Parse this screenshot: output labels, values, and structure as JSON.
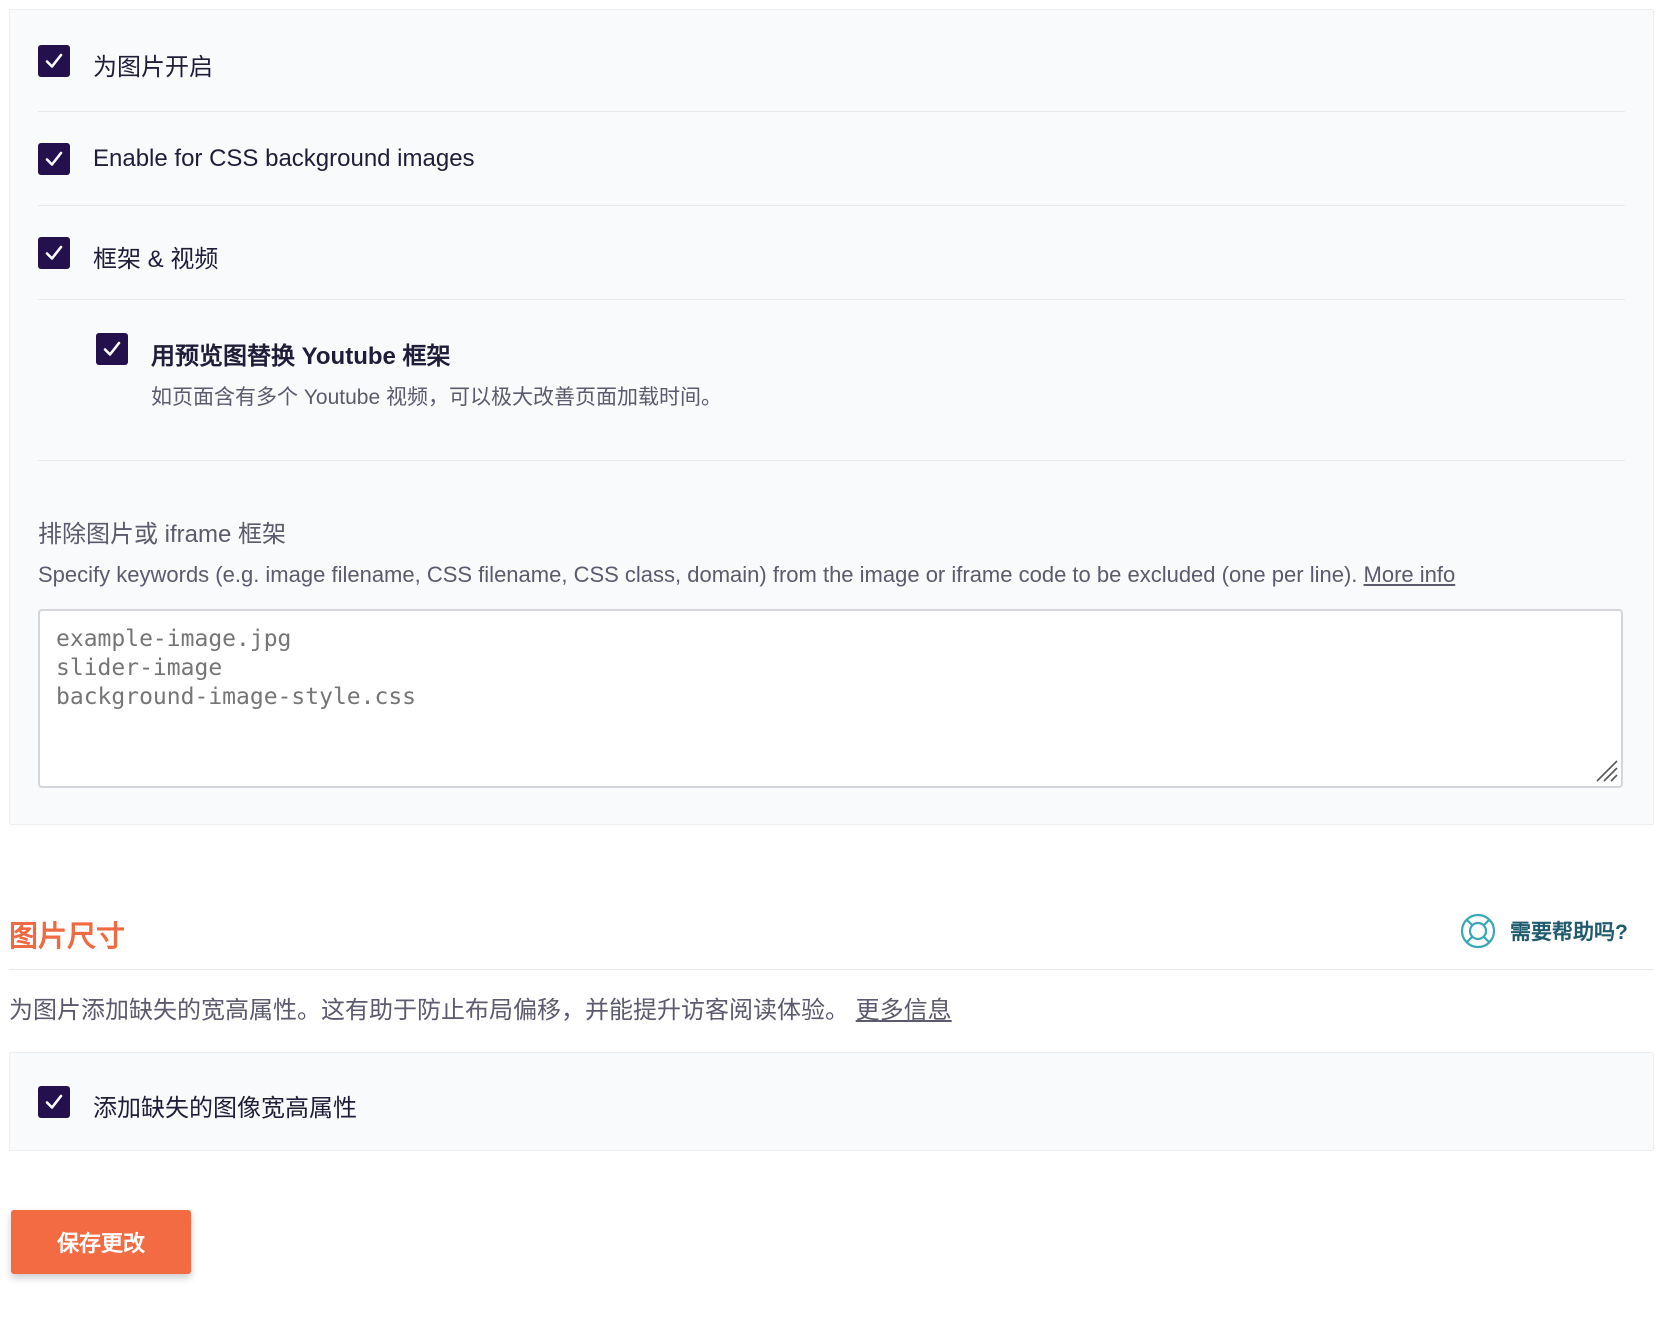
{
  "lazyload": {
    "images_label": "为图片开启",
    "css_bg_label": "Enable for CSS background images",
    "iframes_label": "框架 & 视频",
    "youtube_label": "用预览图替换 Youtube 框架",
    "youtube_desc": "如页面含有多个 Youtube 视频，可以极大改善页面加载时间。",
    "exclusions": {
      "title": "排除图片或 iframe 框架",
      "description": "Specify keywords (e.g. image filename, CSS filename, CSS class, domain) from the image or iframe code to be excluded (one per line).",
      "more_info": "More info",
      "placeholder": "example-image.jpg\nslider-image\nbackground-image-style.css"
    }
  },
  "image_dimensions": {
    "title": "图片尺寸",
    "help_label": "需要帮助吗?",
    "description": "为图片添加缺失的宽高属性。这有助于防止布局偏移，并能提升访客阅读体验。",
    "more_info": "更多信息",
    "add_missing_label": "添加缺失的图像宽高属性"
  },
  "save_button": "保存更改",
  "colors": {
    "accent": "#f26b43",
    "checkbox": "#24104d",
    "help": "#1f5b6d"
  }
}
